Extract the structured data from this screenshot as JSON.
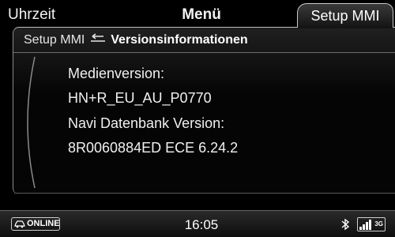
{
  "header": {
    "left_label": "Uhrzeit",
    "center_label": "Menü",
    "active_tab_label": "Setup MMI"
  },
  "breadcrumb": {
    "parent": "Setup MMI",
    "current": "Versionsinformationen"
  },
  "info": {
    "media_version_label": "Medienversion:",
    "media_version_value": "HN+R_EU_AU_P0770",
    "navi_db_label": "Navi Datenbank Version:",
    "navi_db_value": "8R0060884ED ECE 6.24.2"
  },
  "statusbar": {
    "online_label": "ONLINE",
    "time": "16:05",
    "network_type": "3G",
    "icons": [
      "car-icon",
      "bluetooth-icon",
      "signal-strength-icon"
    ]
  }
}
